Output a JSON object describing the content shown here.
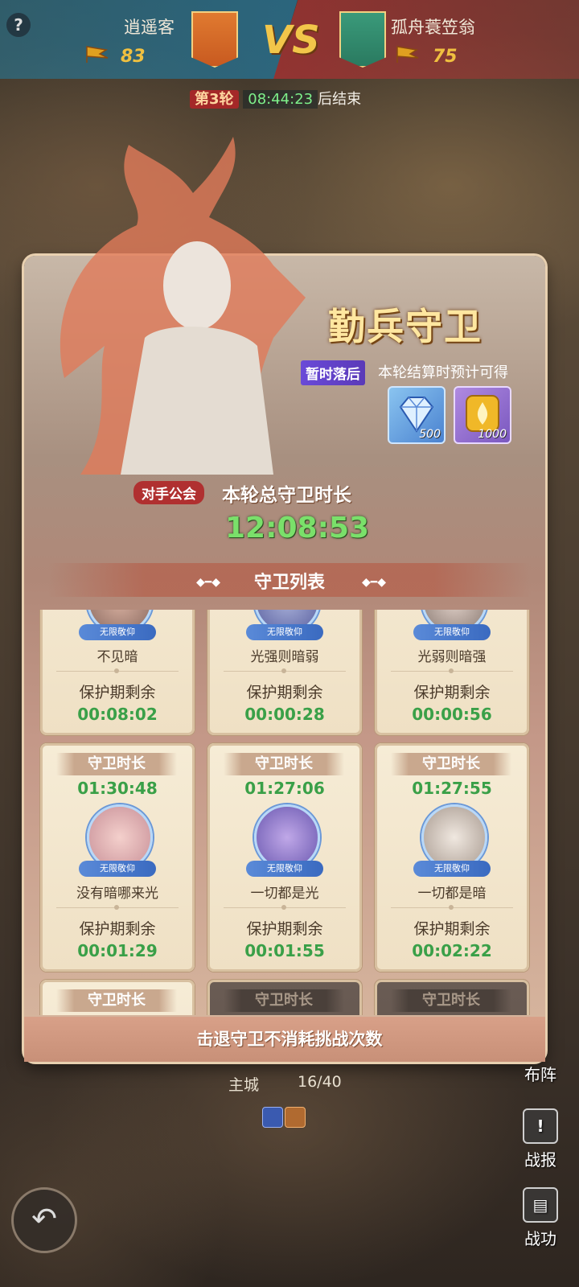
{
  "header": {
    "left_name": "逍遥客",
    "left_score": "83",
    "vs": "VS",
    "right_name": "孤舟蓑笠翁",
    "right_score": "75",
    "round_badge": "第3轮",
    "round_time": "08:44:23",
    "round_suffix": "后结束",
    "colors": {
      "left": "#2878a0",
      "right": "#a03232"
    }
  },
  "panel": {
    "title": "勤兵守卫",
    "status_tag": "暂时落后",
    "expect_text": "本轮结算时预计可得",
    "rewards": [
      {
        "icon": "diamond-icon",
        "qty": "500"
      },
      {
        "icon": "gold-token-icon",
        "qty": "1000"
      }
    ],
    "opponent_tag": "对手公会",
    "total_label": "本轮总守卫时长",
    "total_time": "12:08:53",
    "list_title": "守卫列表",
    "footer_note": "击退守卫不消耗挑战次数"
  },
  "guards": [
    {
      "duration_label": "",
      "duration": "",
      "badge": "无限敬仰",
      "name": "不见暗",
      "prot_label": "保护期剩余",
      "prot": "00:08:02"
    },
    {
      "duration_label": "",
      "duration": "",
      "badge": "无限敬仰",
      "name": "光强则暗弱",
      "prot_label": "保护期剩余",
      "prot": "00:00:28"
    },
    {
      "duration_label": "",
      "duration": "",
      "badge": "无限敬仰",
      "name": "光弱则暗强",
      "prot_label": "保护期剩余",
      "prot": "00:00:56"
    },
    {
      "duration_label": "守卫时长",
      "duration": "01:30:48",
      "badge": "无限敬仰",
      "name": "没有暗哪来光",
      "prot_label": "保护期剩余",
      "prot": "00:01:29"
    },
    {
      "duration_label": "守卫时长",
      "duration": "01:27:06",
      "badge": "无限敬仰",
      "name": "一切都是光",
      "prot_label": "保护期剩余",
      "prot": "00:01:55"
    },
    {
      "duration_label": "守卫时长",
      "duration": "01:27:55",
      "badge": "无限敬仰",
      "name": "一切都是暗",
      "prot_label": "保护期剩余",
      "prot": "00:02:22"
    },
    {
      "duration_label": "守卫时长",
      "duration": "",
      "badge": "",
      "name": "",
      "prot_label": "",
      "prot": ""
    },
    {
      "duration_label": "守卫时长",
      "duration": "",
      "badge": "",
      "name": "",
      "prot_label": "",
      "prot": ""
    },
    {
      "duration_label": "守卫时长",
      "duration": "",
      "badge": "",
      "name": "",
      "prot_label": "",
      "prot": ""
    }
  ],
  "hud": {
    "formation": "布阵",
    "report": "战报",
    "merit": "战功",
    "city_label": "主城",
    "city_count": "16/40",
    "back_icon": "back-arrow-icon"
  }
}
